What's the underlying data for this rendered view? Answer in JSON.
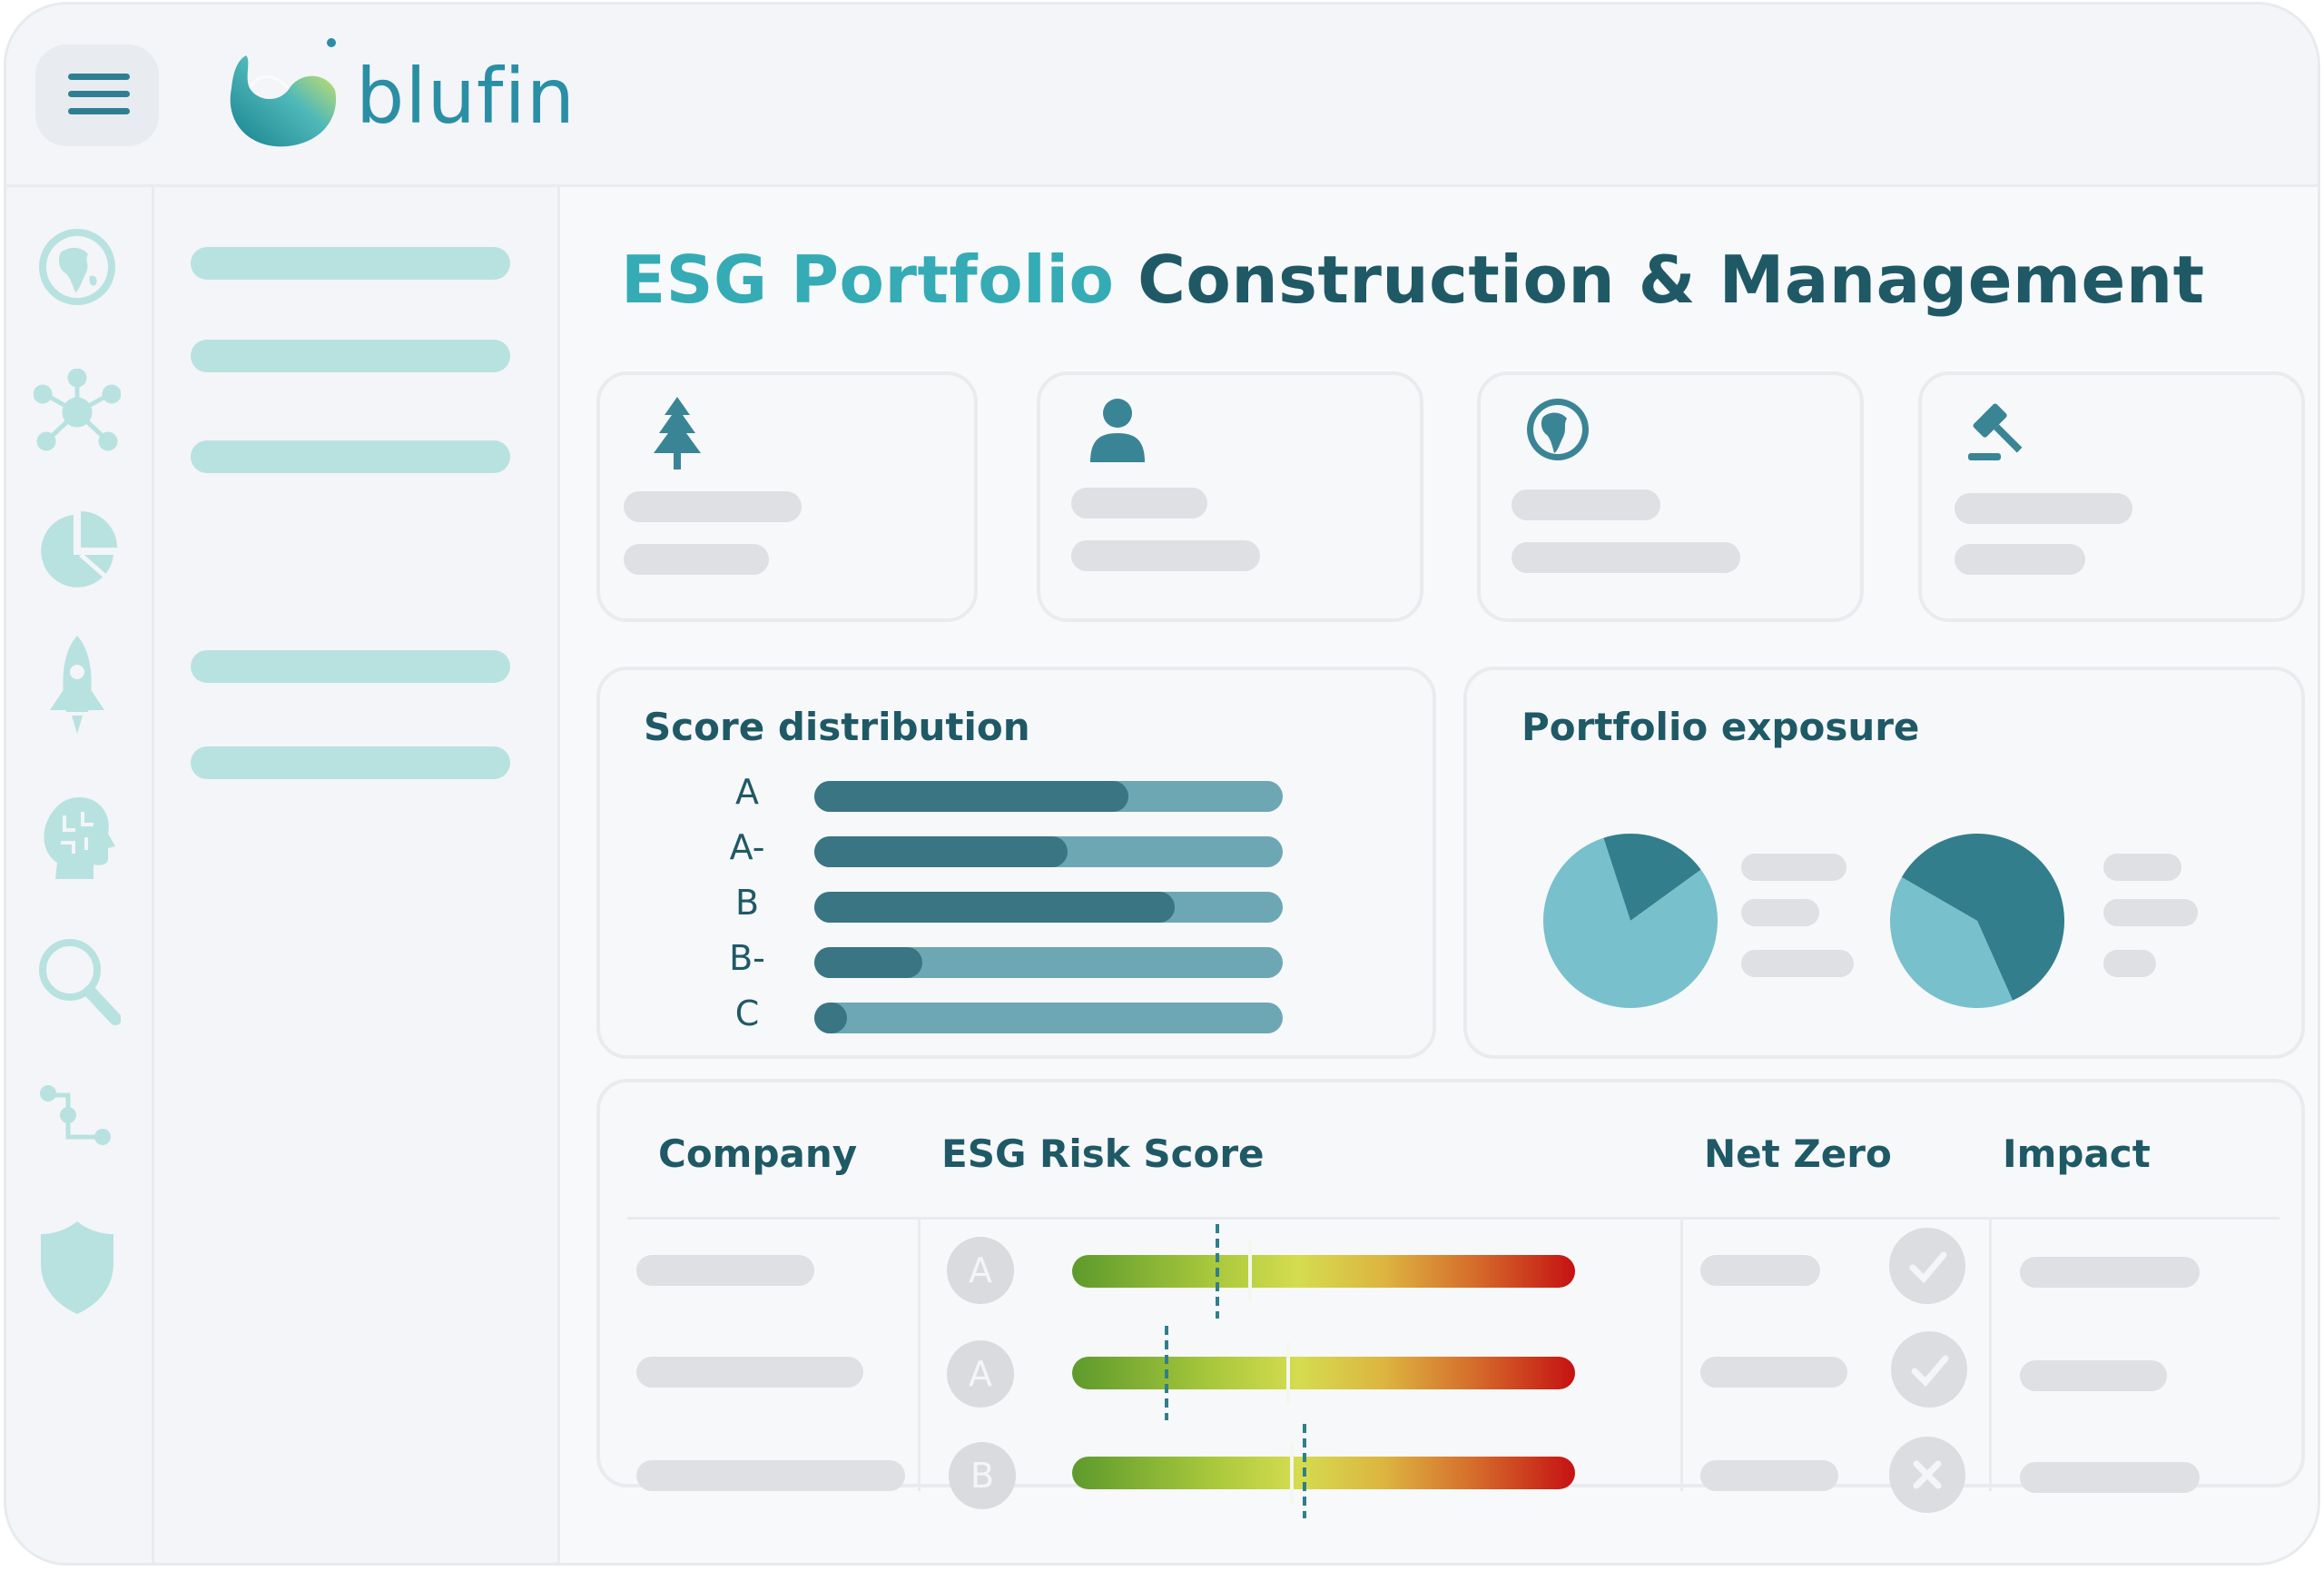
{
  "brand": {
    "name": "blufin",
    "colors": {
      "primary": "#2a8fa5",
      "accent": "#35abb5",
      "dark": "#1f5966",
      "pale": "#b8e2e0"
    }
  },
  "header": {
    "menu_icon": "hamburger-icon"
  },
  "rail": {
    "icons": [
      "globe-icon",
      "network-icon",
      "pie-chart-icon",
      "rocket-icon",
      "brain-icon",
      "search-icon",
      "flow-icon",
      "shield-icon"
    ]
  },
  "page": {
    "title_accent": "ESG Portfolio",
    "title_rest": "Construction & Management"
  },
  "kpi_cards": {
    "icons": [
      "tree-icon",
      "person-icon",
      "globe-icon",
      "gavel-icon"
    ]
  },
  "score_distribution": {
    "title": "Score distribution"
  },
  "portfolio_exposure": {
    "title": "Portfolio exposure"
  },
  "table": {
    "headers": {
      "company": "Company",
      "risk": "ESG Risk Score",
      "net_zero": "Net Zero",
      "impact": "Impact"
    },
    "rows": [
      {
        "grade": "A",
        "net_zero": "check-icon"
      },
      {
        "grade": "A",
        "net_zero": "check-icon"
      },
      {
        "grade": "B",
        "net_zero": "cross-icon"
      }
    ]
  },
  "chart_data": [
    {
      "type": "bar",
      "title": "Score distribution",
      "categories": [
        "A",
        "A-",
        "B",
        "B-",
        "C"
      ],
      "values": [
        0.67,
        0.54,
        0.77,
        0.23,
        0.07
      ],
      "ylim": [
        0,
        1
      ]
    },
    {
      "type": "pie",
      "title": "Portfolio exposure",
      "values": [
        0.2,
        0.8
      ],
      "colors": [
        "#327e8c",
        "#78c0cc"
      ]
    },
    {
      "type": "pie",
      "values": [
        0.6,
        0.4
      ],
      "colors": [
        "#327e8c",
        "#78c0cc"
      ]
    }
  ]
}
